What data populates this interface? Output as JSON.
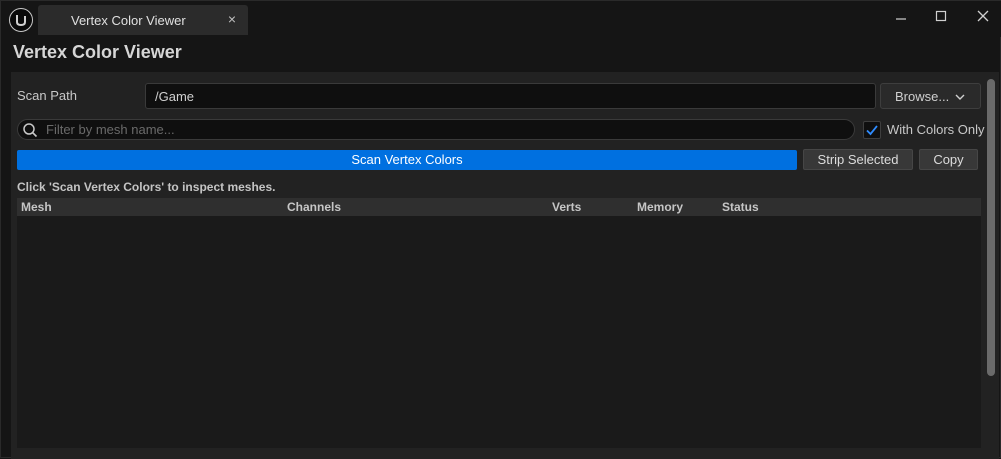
{
  "window": {
    "tab_title": "Vertex Color Viewer",
    "tab_close": "×",
    "page_title": "Vertex Color Viewer"
  },
  "scan": {
    "path_label": "Scan Path",
    "path_value": "/Game",
    "browse_label": "Browse..."
  },
  "filter": {
    "placeholder": "Filter by mesh name...",
    "with_colors_only_label": "With Colors Only",
    "with_colors_only_checked": true
  },
  "actions": {
    "scan_label": "Scan Vertex Colors",
    "strip_label": "Strip Selected",
    "copy_label": "Copy"
  },
  "status": {
    "hint": "Click 'Scan Vertex Colors' to inspect meshes."
  },
  "table": {
    "columns": [
      "Mesh",
      "Channels",
      "Verts",
      "Memory",
      "Status"
    ],
    "rows": []
  },
  "colors": {
    "accent": "#0070e0",
    "background": "#151515",
    "panel": "#222222"
  },
  "icons": {
    "logo": "unreal-logo-icon",
    "search": "search-icon",
    "checkbox": "checkmark-icon",
    "browse_chevron": "chevron-down-icon"
  }
}
